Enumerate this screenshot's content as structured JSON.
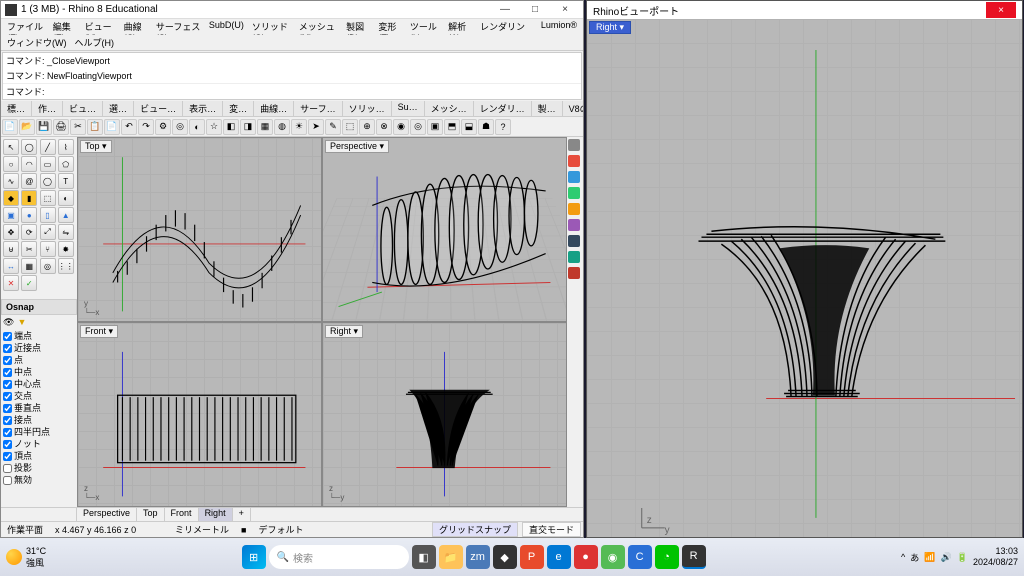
{
  "window": {
    "title": "1 (3 MB) - Rhino 8 Educational",
    "min": "—",
    "max": "□",
    "close": "×"
  },
  "menu": [
    "ファイル(F)",
    "編集(E)",
    "ビュー(V)",
    "曲線(C)",
    "サーフェス(S)",
    "SubD(U)",
    "ソリッド(O)",
    "メッシュ(M)",
    "製図(D)",
    "変形(T)",
    "ツール(L)",
    "解析(A)",
    "レンダリング(R)",
    "Lumion®"
  ],
  "menu2": [
    "ウィンドウ(W)",
    "ヘルプ(H)"
  ],
  "cmd": {
    "line1": "コマンド: _CloseViewport",
    "line2": "コマンド: NewFloatingViewport",
    "prompt": "コマンド:"
  },
  "tabs": [
    "標…",
    "作…",
    "ビュ…",
    "選…",
    "ビュー…",
    "表示…",
    "変…",
    "曲線…",
    "サーフ…",
    "ソリッ…",
    "Su…",
    "メッシ…",
    "レンダリ…",
    "製…",
    "V8の…"
  ],
  "viewports": {
    "tl": "Top ▾",
    "tr": "Perspective ▾",
    "bl": "Front ▾",
    "br": "Right ▾"
  },
  "osnap": {
    "title": "Osnap",
    "items": [
      "端点",
      "近接点",
      "点",
      "中点",
      "中心点",
      "交点",
      "垂直点",
      "接点",
      "四半円点",
      "ノット",
      "頂点",
      "投影"
    ],
    "disabled": "無効"
  },
  "status_tabs": [
    "Perspective",
    "Top",
    "Front",
    "Right",
    "+"
  ],
  "status_active": "Right",
  "status": {
    "plane": "作業平面",
    "coords": "x 4.467   y 46.166   z 0",
    "units": "ミリメートル",
    "layer_swatch": "■",
    "layer": "デフォルト",
    "gridsnap": "グリッドスナップ",
    "ortho": "直交モード"
  },
  "float": {
    "title": "Rhinoビューポート",
    "label": "Right ▾",
    "close": "×"
  },
  "taskbar": {
    "temp": "31°C",
    "weather": "強風",
    "search_placeholder": "検索",
    "time": "13:03",
    "date": "2024/08/27"
  },
  "colors": {
    "accent": "#3a5fd0",
    "close": "#e81123"
  }
}
